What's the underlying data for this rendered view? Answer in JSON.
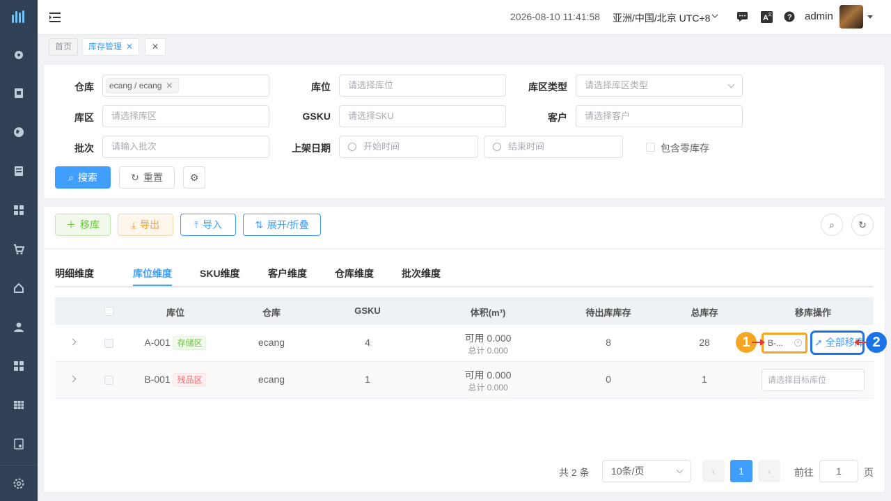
{
  "header": {
    "datetime": "2026-08-10 11:41:58",
    "timezone": "亚洲/中国/北京 UTC+8",
    "username": "admin"
  },
  "tags": [
    {
      "label": "首页"
    },
    {
      "label": "库存管理"
    }
  ],
  "search": {
    "warehouse_label": "仓库",
    "warehouse_chip": "ecang / ecang",
    "location_label": "库位",
    "location_placeholder": "请选择库位",
    "zone_type_label": "库区类型",
    "zone_type_placeholder": "请选择库区类型",
    "zone_label": "库区",
    "zone_placeholder": "请选择库区",
    "gsku_label": "GSKU",
    "gsku_placeholder": "请选择SKU",
    "customer_label": "客户",
    "customer_placeholder": "请选择客户",
    "batch_label": "批次",
    "batch_placeholder": "请输入批次",
    "shelf_date_label": "上架日期",
    "start_placeholder": "开始时间",
    "end_placeholder": "结束时间",
    "zero_stock_label": "包含零库存",
    "search_btn": "搜索",
    "reset_btn": "重置"
  },
  "toolbar": {
    "move_btn": "移库",
    "export_btn": "导出",
    "import_btn": "导入",
    "expand_btn": "展开/折叠"
  },
  "tabs": [
    "明细维度",
    "库位维度",
    "SKU维度",
    "客户维度",
    "仓库维度",
    "批次维度"
  ],
  "table": {
    "headers": [
      "库位",
      "仓库",
      "GSKU",
      "体积(m³)",
      "待出库库存",
      "总库存",
      "移库操作"
    ],
    "rows": [
      {
        "location": "A-001",
        "zone": "存储区",
        "warehouse": "ecang",
        "gsku": "4",
        "vol_avail": "可用 0.000",
        "vol_total": "总计 0.000",
        "pending": "8",
        "total": "28",
        "target": "B-...",
        "move_all": "全部移库"
      },
      {
        "location": "B-001",
        "zone": "残品区",
        "warehouse": "ecang",
        "gsku": "1",
        "vol_avail": "可用 0.000",
        "vol_total": "总计 0.000",
        "pending": "0",
        "total": "1",
        "target_placeholder": "请选择目标库位"
      }
    ]
  },
  "pager": {
    "total": "共 2 条",
    "page_size": "10条/页",
    "current": "1",
    "goto_label": "前往",
    "goto_value": "1",
    "page_suffix": "页"
  },
  "annotations": [
    "1",
    "2"
  ],
  "colors": {
    "primary": "#409eff",
    "sidebar": "#304156",
    "annotation_orange": "#f5a623",
    "annotation_blue": "#1a73e8"
  }
}
